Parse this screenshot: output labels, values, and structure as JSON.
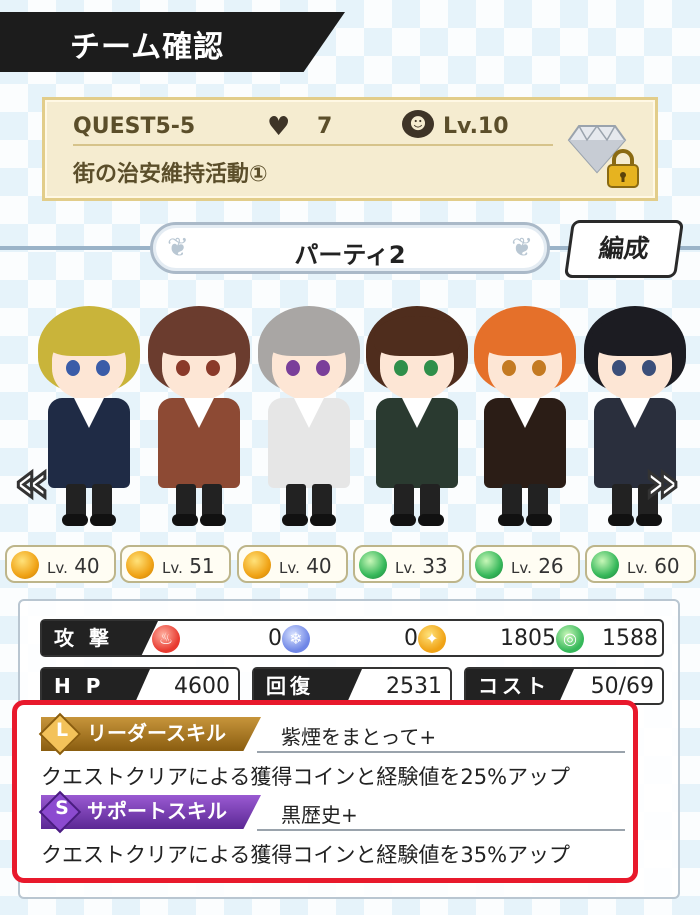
{
  "title": "チーム確認",
  "quest": {
    "id": "QUEST5-5",
    "hearts": "7",
    "level": "Lv.10",
    "name": "街の治安維持活動①"
  },
  "party": {
    "name": "パーティ2",
    "edit_label": "編成",
    "nav_left": "«",
    "nav_right": "»"
  },
  "characters": [
    {
      "hair": "#c9b43a",
      "eyes": "#3a5ca8",
      "outfit": "#1f2b45",
      "level_prefix": "Lv.",
      "level": "40",
      "element": "sun"
    },
    {
      "hair": "#6b3c2e",
      "eyes": "#8a3a2a",
      "outfit": "#8d4a34",
      "level_prefix": "Lv.",
      "level": "51",
      "element": "sun"
    },
    {
      "hair": "#a9a6a4",
      "eyes": "#7a3f9a",
      "outfit": "#e6e6e6",
      "level_prefix": "Lv.",
      "level": "40",
      "element": "sun"
    },
    {
      "hair": "#4f2d1d",
      "eyes": "#2f8f4a",
      "outfit": "#2a3a30",
      "level_prefix": "Lv.",
      "level": "33",
      "element": "wind"
    },
    {
      "hair": "#e5702a",
      "eyes": "#c47a22",
      "outfit": "#2b1d16",
      "level_prefix": "Lv.",
      "level": "26",
      "element": "wind"
    },
    {
      "hair": "#1c1c22",
      "eyes": "#3b4f7a",
      "outfit": "#2a2f3d",
      "level_prefix": "Lv.",
      "level": "60",
      "element": "wind"
    }
  ],
  "stats": {
    "attack_label": "攻 撃",
    "fire": "0",
    "ice": "0",
    "sun": "1805",
    "wind": "1588",
    "hp_label": "H P",
    "hp": "4600",
    "recovery_label": "回復",
    "recovery": "2531",
    "cost_label": "コスト",
    "cost": "50/69"
  },
  "skills": {
    "leader_letter": "L",
    "leader_label": "リーダースキル",
    "leader_name": "紫煙をまとって+",
    "leader_desc": "クエストクリアによる獲得コインと経験値を25%アップ",
    "support_letter": "S",
    "support_label": "サポートスキル",
    "support_name": "黒歴史+",
    "support_desc": "クエストクリアによる獲得コインと経験値を35%アップ"
  },
  "colors": {
    "highlight_frame": "#e8192c",
    "leader_gold": "#c7953b",
    "support_purple": "#7a3fb8"
  }
}
